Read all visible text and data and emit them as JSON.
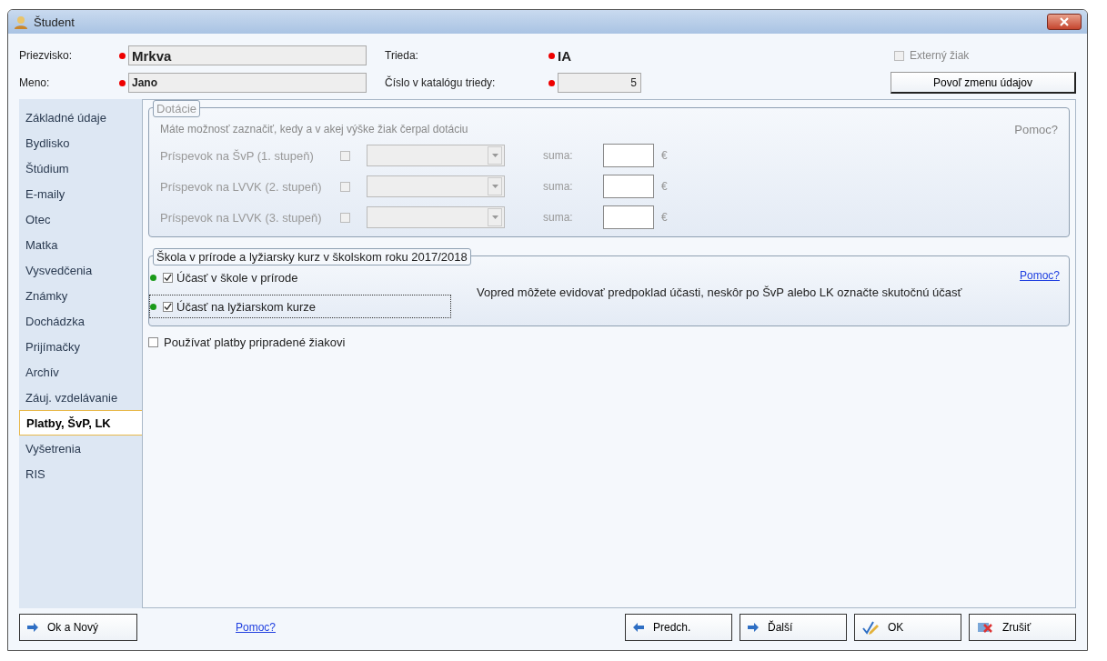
{
  "window": {
    "title": "Študent"
  },
  "header": {
    "surname": {
      "label": "Priezvisko:",
      "value": "Mrkva"
    },
    "first_name": {
      "label": "Meno:",
      "value": "Jano"
    },
    "class": {
      "label": "Trieda:",
      "value": "IA"
    },
    "catalog_number": {
      "label": "Číslo v katalógu triedy:",
      "value": "5"
    },
    "external": {
      "label": "Externý žiak",
      "checked": false,
      "disabled": true
    },
    "unlock_button": "Povoľ zmenu údajov"
  },
  "nav": [
    {
      "label": "Základné údaje",
      "selected": false
    },
    {
      "label": "Bydlisko",
      "selected": false
    },
    {
      "label": "Štúdium",
      "selected": false
    },
    {
      "label": "E-maily",
      "selected": false
    },
    {
      "label": "Otec",
      "selected": false
    },
    {
      "label": "Matka",
      "selected": false
    },
    {
      "label": "Vysvedčenia",
      "selected": false
    },
    {
      "label": "Známky",
      "selected": false
    },
    {
      "label": "Dochádzka",
      "selected": false
    },
    {
      "label": "Prijímačky",
      "selected": false
    },
    {
      "label": "Archív",
      "selected": false
    },
    {
      "label": "Záuj. vzdelávanie",
      "selected": false
    },
    {
      "label": "Platby, ŠvP, LK",
      "selected": true
    },
    {
      "label": "Vyšetrenia",
      "selected": false
    },
    {
      "label": "RIS",
      "selected": false
    }
  ],
  "subsidies": {
    "title": "Dotácie",
    "disabled": true,
    "description": "Máte možnosť zaznačiť, kedy a v akej výške žiak čerpal dotáciu",
    "help": "Pomoc?",
    "rows": [
      {
        "label": "Príspevok na ŠvP (1. stupeň)",
        "checked": false,
        "sum_label": "suma:",
        "currency": "€"
      },
      {
        "label": "Príspevok na LVVK (2. stupeň)",
        "checked": false,
        "sum_label": "suma:",
        "currency": "€"
      },
      {
        "label": "Príspevok na LVVK (3. stupeň)",
        "checked": false,
        "sum_label": "suma:",
        "currency": "€"
      }
    ]
  },
  "outdoor": {
    "title": "Škola v prírode a lyžiarsky kurz v školskom roku 2017/2018",
    "help": "Pomoc?",
    "items": [
      {
        "label": "Účasť v škole v prírode",
        "checked": true,
        "focused": false
      },
      {
        "label": "Účasť na lyžiarskom kurze",
        "checked": true,
        "focused": true
      }
    ],
    "note": "Vopred môžete evidovať predpoklad účasti, neskôr po ŠvP alebo LK označte skutočnú účasť"
  },
  "use_payments": {
    "label": "Používať platby pripradené žiakovi",
    "checked": false
  },
  "footer": {
    "ok_new": "Ok a Nový",
    "help": "Pomoc?",
    "buttons": [
      {
        "kind": "prev",
        "label": "Predch."
      },
      {
        "kind": "next",
        "label": "Ďalší"
      },
      {
        "kind": "ok",
        "label": "OK"
      },
      {
        "kind": "cancel",
        "label": "Zrušiť"
      }
    ]
  }
}
